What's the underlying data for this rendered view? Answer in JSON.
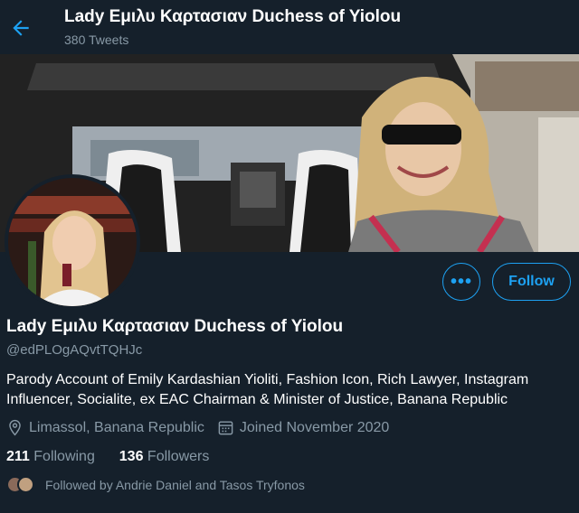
{
  "header": {
    "title": "Lady Εμιλυ Καρτασιαν Duchess of Yiolou",
    "tweet_count": "380 Tweets"
  },
  "profile": {
    "display_name": "Lady Εμιλυ Καρτασιαν Duchess of Yiolou",
    "handle": "@edPLOgAQvtTQHJc",
    "bio": "Parody Account of Emily Kardashian Yioliti, Fashion Icon, Rich Lawyer, Instagram Influencer, Socialite,  ex EAC Chairman & Minister of Justice, Banana Republic",
    "location": "Limassol, Banana Republic",
    "joined": "Joined November 2020",
    "following_count": "211",
    "following_label": "Following",
    "followers_count": "136",
    "followers_label": "Followers",
    "followed_by": "Followed by Andrie Daniel and Tasos Tryfonos"
  },
  "actions": {
    "more_label": "•••",
    "follow_label": "Follow"
  },
  "colors": {
    "background": "#15202b",
    "accent": "#1da1f2",
    "secondary_text": "#8899a6"
  },
  "icons": [
    "back-arrow-icon",
    "more-icon",
    "location-pin-icon",
    "calendar-icon"
  ]
}
